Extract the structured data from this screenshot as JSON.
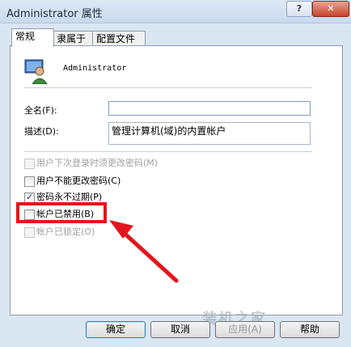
{
  "window": {
    "title": "Administrator 属性",
    "help_label": "?",
    "close_label": "✕"
  },
  "tabs": [
    "常规",
    "隶属于",
    "配置文件"
  ],
  "user": {
    "name": "Administrator"
  },
  "fields": {
    "fullname_label": "全名(F):",
    "fullname_value": "",
    "desc_label": "描述(D):",
    "desc_value": "管理计算机(域)的内置帐户"
  },
  "checkboxes": [
    {
      "label": "用户下次登录时须更改密码(M)",
      "checked": false,
      "enabled": false
    },
    {
      "label": "用户不能更改密码(C)",
      "checked": false,
      "enabled": true
    },
    {
      "label": "密码永不过期(P)",
      "checked": true,
      "enabled": true
    },
    {
      "label": "帐户已禁用(B)",
      "checked": false,
      "enabled": true
    },
    {
      "label": "帐户已锁定(O)",
      "checked": false,
      "enabled": false
    }
  ],
  "buttons": {
    "ok": "确定",
    "cancel": "取消",
    "apply": "应用(A)",
    "help": "帮助"
  },
  "watermark": "装机之家",
  "colors": {
    "highlight": "#e4151c",
    "titlebar": "#dfe9f5"
  }
}
